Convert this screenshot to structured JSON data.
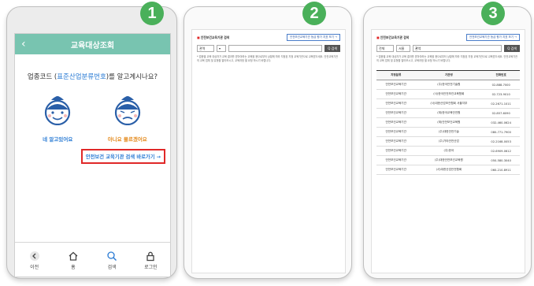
{
  "steps": [
    "1",
    "2",
    "3"
  ],
  "screen1": {
    "back_icon": "chevron-left-icon",
    "title": "교육대상조회",
    "question_prefix": "업종코드 (",
    "question_link": "표준산업분류번호",
    "question_suffix": ")를 알고계시나요?",
    "yes_label": "네 알고있어요",
    "no_label": "아니요 몰르겠어요",
    "link_text": "안전보건 교육기관 검색 ",
    "link_go": "바로가기 →",
    "nav": [
      {
        "label": "이전",
        "icon": "chevron-left-circle-icon"
      },
      {
        "label": "홈",
        "icon": "home-icon"
      },
      {
        "label": "검색",
        "icon": "search-icon"
      },
      {
        "label": "로그인",
        "icon": "lock-icon"
      }
    ],
    "colors": {
      "topbar": "#78c4b0",
      "accent": "#2a7bd4",
      "highlight": "#e02828",
      "badge": "#4ab05a"
    }
  },
  "screen2": {
    "section_title": "안전보건교육기관 검색",
    "top_button": "안전보건교육기관 등급 평가 지표 보기 →",
    "select_value": "관역",
    "search_button": "Q 검색",
    "note": "* 업종별 교육 대상자가 교육 결과를 받아야하는 교육을 용으로부터 상황에 따라 지정된 지정 교육기관으로 교육받으세요. 안전교육기관의 교육 업체 및 유형을 알아보시고, 교육과정 별 요청 하시기 바랍니다."
  },
  "screen3": {
    "section_title": "안전보건교육기관 검색",
    "top_button": "안전보건교육기관 등급 평가 지표 보기 →",
    "select_value": "전체",
    "select_value2": "서울",
    "input_value": "관악",
    "search_button": "Q 검색",
    "note": "* 업종별 교육 대상자가 교육 결과를 받아야하는 교육을 용으로부터 상황에 따라 지정된 지정 교육기관으로 교육받으세요. 안전교육기관의 교육 업체 및 유형을 알아보시고, 교육과정 별 요청 하시기 바랍니다.",
    "table": {
      "headers": [
        "지정분류",
        "기관명",
        "전화번호"
      ],
      "rows": [
        [
          "안전보건교육기관",
          "(주)한국안전기술원",
          "02-888-7000"
        ],
        [
          "안전보건교육기관",
          "(사)한국안전보건교육협회",
          "02-723-9010"
        ],
        [
          "안전보건교육기관",
          "(사)대한산업보건협회 서울지부",
          "02-2671-1011"
        ],
        [
          "안전보건교육기관",
          "(재)한국교육안전원",
          "02-857-6090"
        ],
        [
          "안전보건교육기관",
          "(재)안전보건교육원",
          "032-460-0624"
        ],
        [
          "안전보건교육기관",
          "(주)대한안전기술",
          "080-771-7900"
        ],
        [
          "안전보건교육기관",
          "(주)가야안전산업",
          "02-2168-0053"
        ],
        [
          "안전보건교육기관",
          "(주)한국",
          "02-6909-0612"
        ],
        [
          "안전보건교육기관",
          "(주)대한안전보건교육원",
          "050-580-3040"
        ],
        [
          "안전보건교육기관",
          "(사)대한산업안전협회",
          "060-210-8911"
        ]
      ]
    }
  }
}
